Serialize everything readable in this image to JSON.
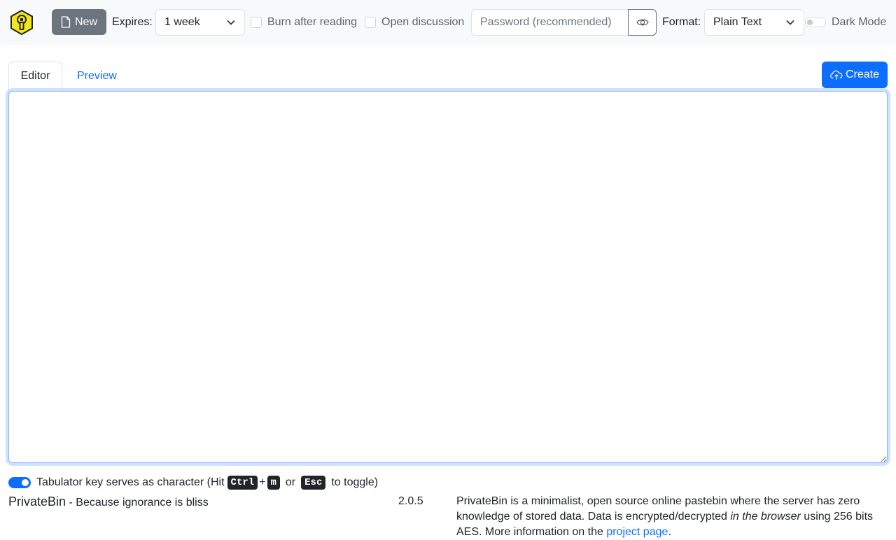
{
  "navbar": {
    "new_label": "New",
    "expires_label": "Expires:",
    "expires_value": "1 week",
    "burn_label": "Burn after reading",
    "discussion_label": "Open discussion",
    "password_placeholder": "Password (recommended)",
    "format_label": "Format:",
    "format_value": "Plain Text",
    "dark_mode_label": "Dark Mode",
    "dark_mode_on": false
  },
  "tabs": {
    "editor": "Editor",
    "preview": "Preview"
  },
  "create_label": "Create",
  "editor": {
    "value": ""
  },
  "tab_toggle": {
    "enabled": true,
    "text_before": "Tabulator key serves as character (Hit",
    "key_ctrl": "Ctrl",
    "plus": "+",
    "key_m": "m",
    "or": "or",
    "key_esc": "Esc",
    "text_after": "to toggle)"
  },
  "footer": {
    "brand_name": "PrivateBin",
    "brand_tagline": " - Because ignorance is bliss",
    "version": "2.0.5",
    "about_part1": "PrivateBin is a minimalist, open source online pastebin where the server has zero knowledge of stored data. Data is encrypted/decrypted ",
    "about_em": "in the browser",
    "about_part2": " using 256 bits AES. More information on the ",
    "about_link": "project page",
    "about_part3": "."
  },
  "colors": {
    "primary": "#0d6efd",
    "secondary": "#6c757d",
    "logo_yellow": "#f5e61a"
  },
  "icons": [
    "key-logo-icon",
    "document-icon",
    "chevron-down-icon",
    "eye-icon",
    "cloud-upload-icon"
  ]
}
